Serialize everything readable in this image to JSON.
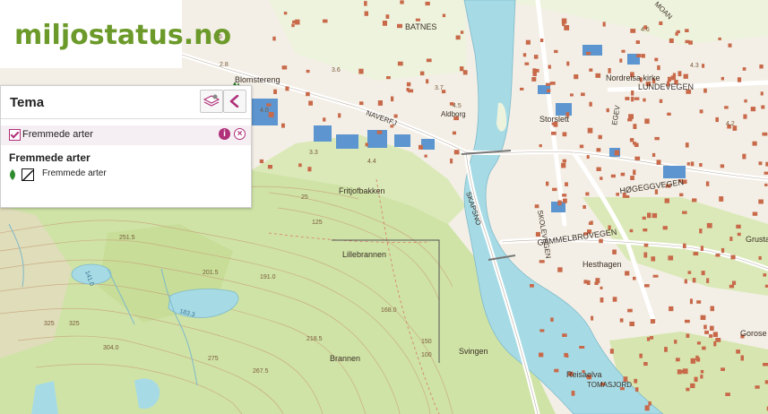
{
  "logo": {
    "text": "miljostatus.no"
  },
  "panel": {
    "title": "Tema",
    "layer": {
      "label": "Fremmede arter",
      "checked": true
    },
    "legend": {
      "title": "Fremmede arter",
      "item_label": "Fremmede arter"
    },
    "info_icon": "i",
    "close_icon": "×"
  },
  "map": {
    "place_labels": [
      "Blomstereng",
      "BATNES",
      "NAVERFJ",
      "Aldborg",
      "Storslett",
      "Nordreisa kirke",
      "LUNDEVEGEN",
      "EGEV",
      "HØGEGGVEGEN",
      "GAMMELBRUVEGEN",
      "SKOLEVEGEN",
      "SKAPSNO",
      "Fritjofbakken",
      "Lillebrannen",
      "Hesthagen",
      "Brannen",
      "Svingen",
      "Reisaelva",
      "TOMASJORD",
      "Grusta",
      "Gorose",
      "MOAN"
    ],
    "water_labels": [
      "141.0",
      "183.3"
    ],
    "elevations": [
      "251.5",
      "201.5",
      "191.0",
      "218.5",
      "168.0",
      "304.0",
      "325",
      "267.5",
      "275",
      "125",
      "25",
      "150",
      "325",
      "100",
      "3.5",
      "2.8",
      "4.0",
      "3.6",
      "3.7",
      "4.5",
      "4.6",
      "4.2",
      "4.3",
      "3.3",
      "4.4"
    ],
    "colors": {
      "water": "#a6dbe6",
      "forest": "#cfe3a6",
      "land": "#f3efe6",
      "buildings_red": "#c8694a",
      "buildings_blue": "#5c95cf",
      "road": "#ffffff",
      "contour": "#c9a07a"
    }
  }
}
